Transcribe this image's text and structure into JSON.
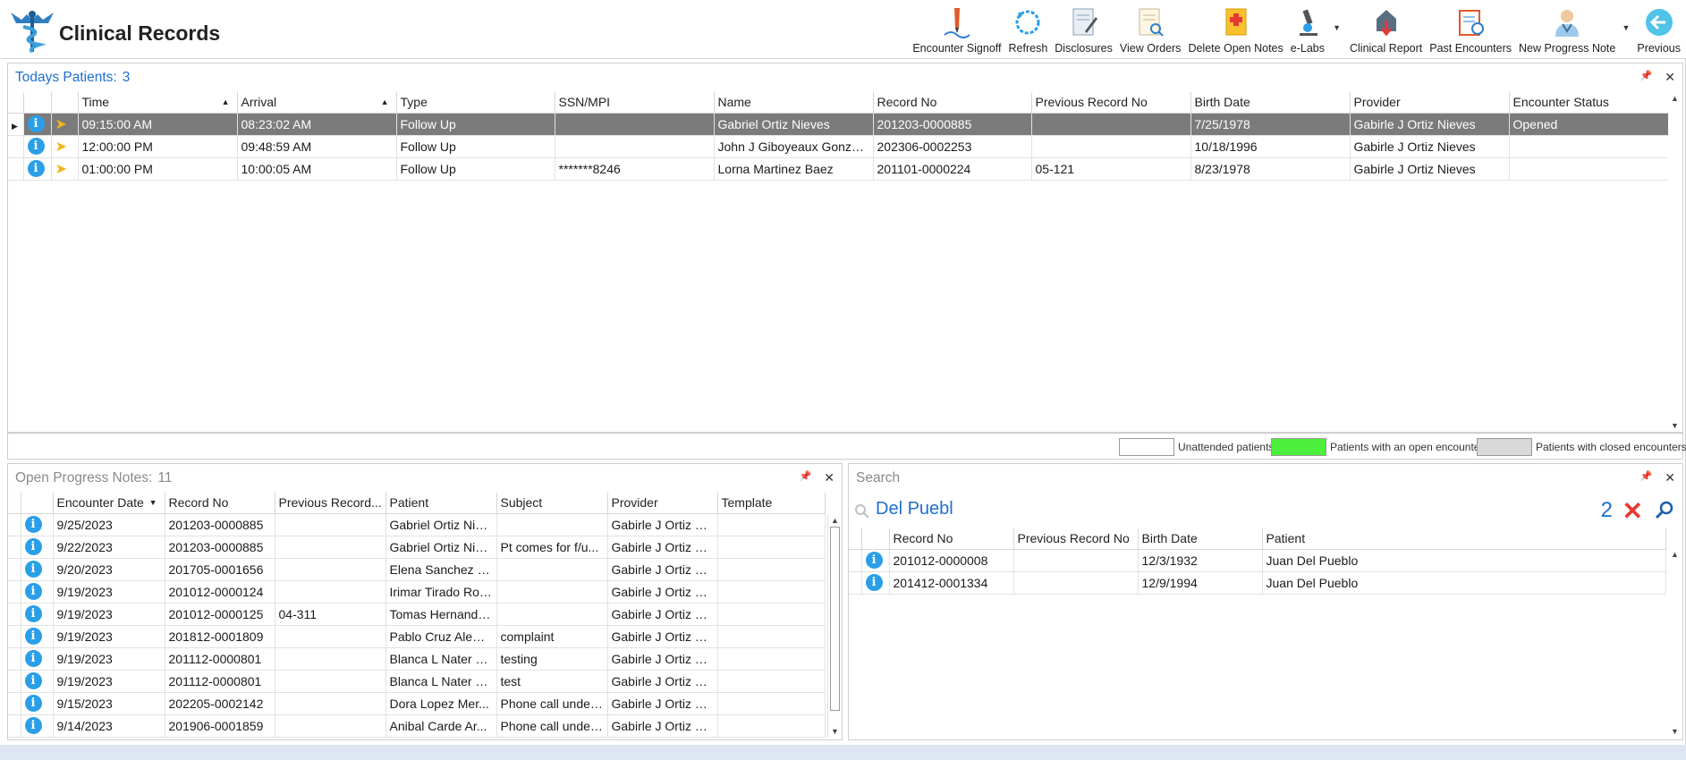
{
  "app": {
    "title": "Clinical Records"
  },
  "toolbar": [
    {
      "label": "Encounter Signoff",
      "icon": "signoff-icon"
    },
    {
      "label": "Refresh",
      "icon": "refresh-icon"
    },
    {
      "label": "Disclosures",
      "icon": "disclosures-icon"
    },
    {
      "label": "View Orders",
      "icon": "view-orders-icon"
    },
    {
      "label": "Delete Open Notes",
      "icon": "delete-notes-icon"
    },
    {
      "label": "e-Labs",
      "icon": "microscope-icon"
    },
    {
      "label": "Clinical Report",
      "icon": "clinical-report-icon"
    },
    {
      "label": "Past Encounters",
      "icon": "past-encounters-icon"
    },
    {
      "label": "New Progress Note",
      "icon": "doctor-icon"
    },
    {
      "label": "Previous",
      "icon": "back-arrow-icon"
    }
  ],
  "today": {
    "title": "Todays Patients:",
    "count": "3",
    "columns": [
      "Time",
      "Arrival",
      "Type",
      "SSN/MPI",
      "Name",
      "Record No",
      "Previous Record No",
      "Birth Date",
      "Provider",
      "Encounter Status"
    ],
    "rows": [
      [
        "09:15:00 AM",
        "08:23:02 AM",
        "Follow Up",
        "",
        "Gabriel Ortiz Nieves",
        "201203-0000885",
        "",
        "7/25/1978",
        "Gabirle J Ortiz Nieves",
        "Opened"
      ],
      [
        "12:00:00 PM",
        "09:48:59 AM",
        "Follow Up",
        "",
        "John J Giboyeaux Gonzalez",
        "202306-0002253",
        "",
        "10/18/1996",
        "Gabirle J Ortiz Nieves",
        ""
      ],
      [
        "01:00:00 PM",
        "10:00:05 AM",
        "Follow Up",
        "*******8246",
        "Lorna Martinez Baez",
        "201101-0000224",
        "05-121",
        "8/23/1978",
        "Gabirle J Ortiz Nieves",
        ""
      ]
    ]
  },
  "legend": {
    "unattended": "Unattended patients",
    "open": "Patients with an open encounter",
    "closed": "Patients with closed encounters",
    "colors": {
      "unattended": "#ffffff",
      "open": "#4cf03c",
      "closed": "#d9d9d9"
    }
  },
  "notes": {
    "title": "Open Progress Notes:",
    "count": "11",
    "columns": [
      "Encounter Date",
      "Record No",
      "Previous Record...",
      "Patient",
      "Subject",
      "Provider",
      "Template"
    ],
    "rows": [
      [
        "9/25/2023",
        "201203-0000885",
        "",
        "Gabriel Ortiz Nie...",
        "",
        "Gabirle J Ortiz N...",
        ""
      ],
      [
        "9/22/2023",
        "201203-0000885",
        "",
        "Gabriel Ortiz Nie...",
        "Pt comes for f/u...",
        "Gabirle J Ortiz N...",
        ""
      ],
      [
        "9/20/2023",
        "201705-0001656",
        "",
        "Elena Sanchez Ri...",
        "",
        "Gabirle J Ortiz N...",
        ""
      ],
      [
        "9/19/2023",
        "201012-0000124",
        "",
        "Irimar Tirado Rol...",
        "",
        "Gabirle J Ortiz N...",
        ""
      ],
      [
        "9/19/2023",
        "201012-0000125",
        "04-311",
        "Tomas Hernande...",
        "",
        "Gabirle J Ortiz N...",
        ""
      ],
      [
        "9/19/2023",
        "201812-0001809",
        "",
        "Pablo Cruz Alem...",
        "complaint",
        "Gabirle J Ortiz N...",
        ""
      ],
      [
        "9/19/2023",
        "201112-0000801",
        "",
        "Blanca L Nater B...",
        "testing",
        "Gabirle J Ortiz N...",
        ""
      ],
      [
        "9/19/2023",
        "201112-0000801",
        "",
        "Blanca L Nater B...",
        "test",
        "Gabirle J Ortiz N...",
        ""
      ],
      [
        "9/15/2023",
        "202205-0002142",
        "",
        "Dora Lopez Mer...",
        "Phone call under...",
        "Gabirle J Ortiz N...",
        ""
      ],
      [
        "9/14/2023",
        "201906-0001859",
        "",
        "Anibal Carde Ar...",
        "Phone call under...",
        "Gabirle J Ortiz N...",
        ""
      ]
    ]
  },
  "search": {
    "title": "Search",
    "value": "Del Puebl",
    "count": "2",
    "columns": [
      "Record No",
      "Previous Record No",
      "Birth Date",
      "Patient"
    ],
    "rows": [
      [
        "201012-0000008",
        "",
        "12/3/1932",
        "Juan Del Pueblo"
      ],
      [
        "201412-0001334",
        "",
        "12/9/1994",
        "Juan Del Pueblo"
      ]
    ]
  }
}
